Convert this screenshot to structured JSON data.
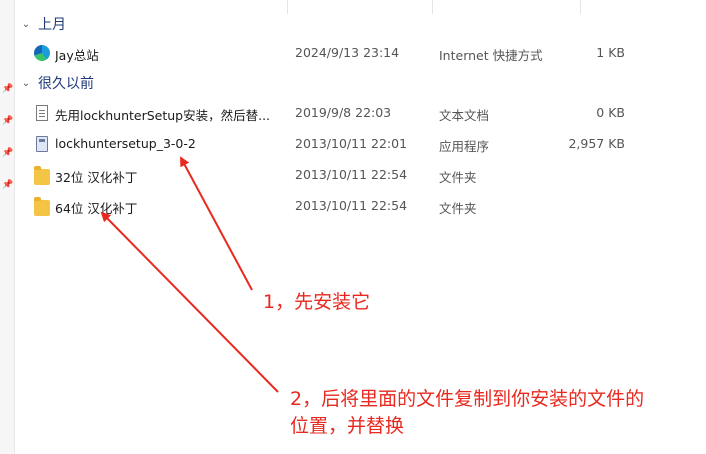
{
  "groups": {
    "last_month": "上月",
    "long_ago": "很久以前"
  },
  "files": [
    {
      "name": "Jay总站",
      "date": "2024/9/13 23:14",
      "type": "Internet 快捷方式",
      "size": "1 KB",
      "icon": "edge-shortcut-icon"
    },
    {
      "name": "先用lockhunterSetup安装，然后替...",
      "date": "2019/9/8 22:03",
      "type": "文本文档",
      "size": "0 KB",
      "icon": "text-document-icon"
    },
    {
      "name": "lockhuntersetup_3-0-2",
      "date": "2013/10/11 22:01",
      "type": "应用程序",
      "size": "2,957 KB",
      "icon": "application-icon"
    },
    {
      "name": "32位 汉化补丁",
      "date": "2013/10/11 22:54",
      "type": "文件夹",
      "size": "",
      "icon": "folder-icon"
    },
    {
      "name": "64位 汉化补丁",
      "date": "2013/10/11 22:54",
      "type": "文件夹",
      "size": "",
      "icon": "folder-icon"
    }
  ],
  "annotations": {
    "step1": "1，先安装它",
    "step2_line1": "2，后将里面的文件复制到你安装的文件的",
    "step2_line2": "位置，并替换"
  },
  "colors": {
    "annotation": "#e8291f",
    "group_header": "#1e3a78",
    "folder": "#f4c544"
  }
}
